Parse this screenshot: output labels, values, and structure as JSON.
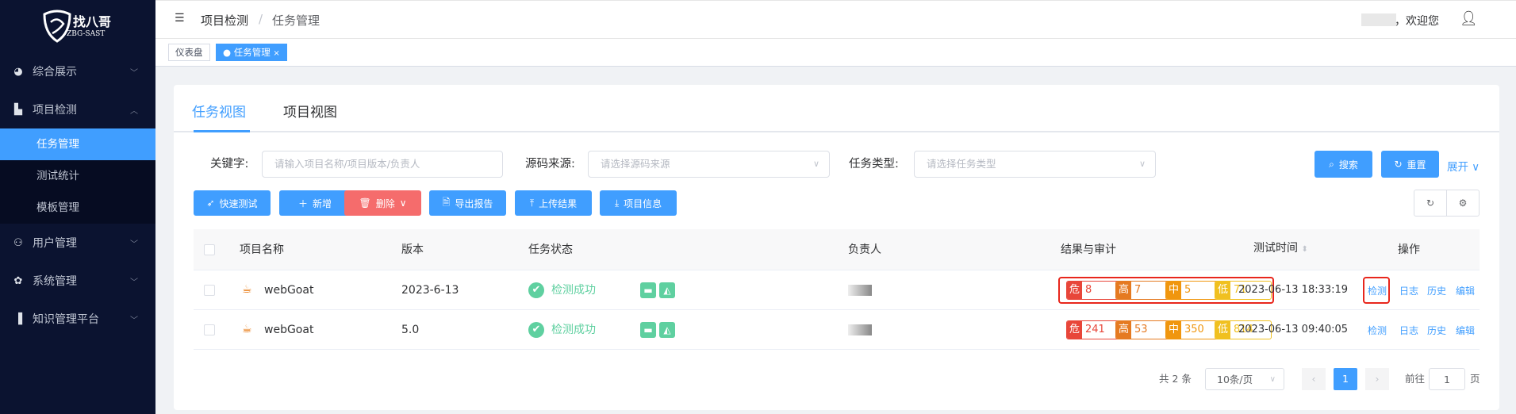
{
  "logo": {
    "name": "找八哥",
    "sub": "ZBG-SAST"
  },
  "sidebar": {
    "items": [
      {
        "label": "综合展示",
        "icon": "dashboard-icon",
        "expanded": false
      },
      {
        "label": "项目检测",
        "icon": "document-icon",
        "expanded": true,
        "children": [
          {
            "label": "任务管理",
            "active": true
          },
          {
            "label": "测试统计"
          },
          {
            "label": "模板管理"
          }
        ]
      },
      {
        "label": "用户管理",
        "icon": "users-icon",
        "expanded": false
      },
      {
        "label": "系统管理",
        "icon": "gear-icon",
        "expanded": false
      },
      {
        "label": "知识管理平台",
        "icon": "book-icon",
        "expanded": false
      }
    ]
  },
  "header": {
    "breadcrumb": [
      "项目检测",
      "任务管理"
    ],
    "separator": "/",
    "user_greeting": "，欢迎您"
  },
  "tags": [
    {
      "label": "仪表盘"
    },
    {
      "label": "任务管理",
      "active": true,
      "close": "×"
    }
  ],
  "tabs": [
    {
      "label": "任务视图",
      "active": true
    },
    {
      "label": "项目视图"
    }
  ],
  "filters": {
    "keyword": {
      "label": "关键字:",
      "placeholder": "请输入项目名称/项目版本/负责人"
    },
    "source": {
      "label": "源码来源:",
      "placeholder": "请选择源码来源"
    },
    "type": {
      "label": "任务类型:",
      "placeholder": "请选择任务类型"
    },
    "search": "搜索",
    "reset": "重置",
    "expand": "展开"
  },
  "toolbar": {
    "quick_test": "快速测试",
    "add": "新增",
    "delete": "删除",
    "export": "导出报告",
    "upload": "上传结果",
    "project_info": "项目信息"
  },
  "table": {
    "headers": {
      "name": "项目名称",
      "version": "版本",
      "status": "任务状态",
      "owner": "负责人",
      "results": "结果与审计",
      "time": "测试时间",
      "actions": "操作"
    },
    "severity_labels": {
      "critical": "危",
      "high": "高",
      "medium": "中",
      "low": "低"
    },
    "rows": [
      {
        "name": "webGoat",
        "version": "2023-6-13",
        "status": "检测成功",
        "critical": "8",
        "high": "7",
        "medium": "5",
        "low": "71",
        "time": "2023-06-13 18:33:19",
        "highlighted": true
      },
      {
        "name": "webGoat",
        "version": "5.0",
        "status": "检测成功",
        "critical": "241",
        "high": "53",
        "medium": "350",
        "low": "814",
        "time": "2023-06-13 09:40:05",
        "highlighted": false
      }
    ],
    "actions": [
      "检测",
      "日志",
      "历史",
      "编辑"
    ]
  },
  "pagination": {
    "total": "共 2 条",
    "page_size": "10条/页",
    "current": "1",
    "goto_label": "前往",
    "goto_value": "1",
    "page_suffix": "页",
    "prev": "‹",
    "next": "›"
  },
  "colors": {
    "primary": "#409eff",
    "critical": "#e8463a",
    "high": "#e57a21",
    "medium": "#f0960e",
    "low": "#f0c020",
    "success": "#5fd0a0",
    "highlight": "#e8261c"
  }
}
